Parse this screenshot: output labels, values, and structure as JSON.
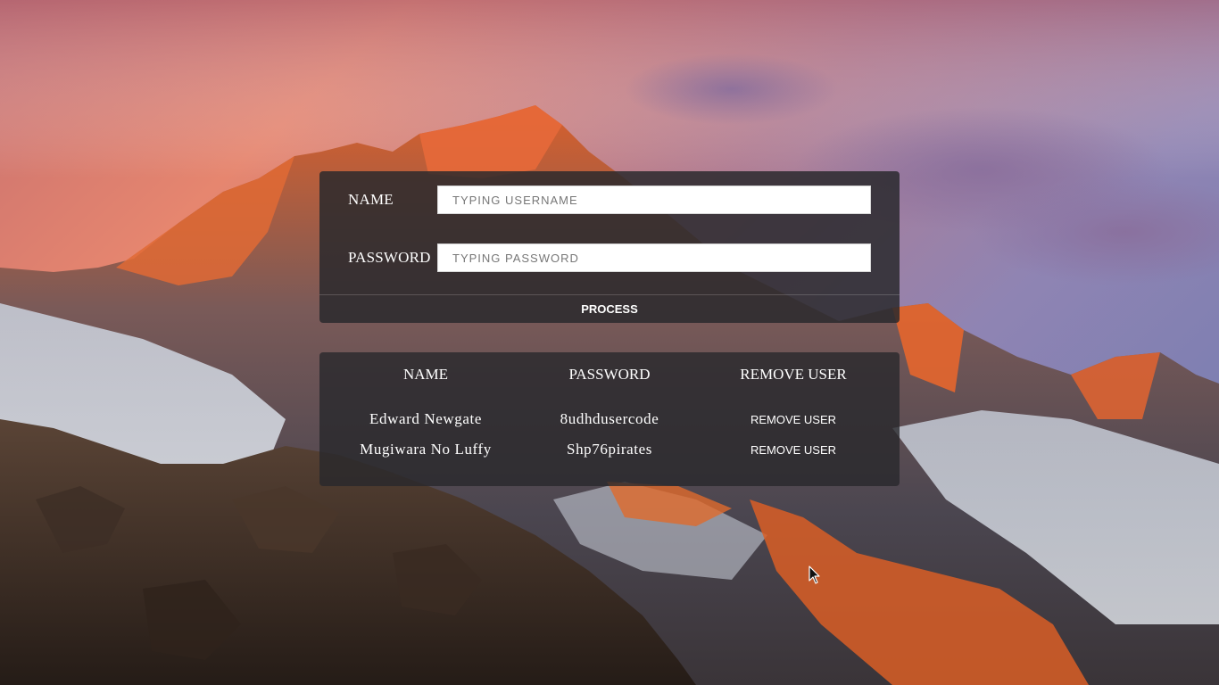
{
  "background": {
    "scene": "mountain-sunset",
    "sky_top": "#b9707a",
    "sky_glow": "#ef8d72",
    "sky_right": "#8b82b4",
    "rock_lit": "#e0622c",
    "rock_dark": "#2e241f",
    "snow": "#d6dde6"
  },
  "form": {
    "name_label": "NAME",
    "name_placeholder": "TYPING USERNAME",
    "name_value": "",
    "password_label": "PASSWORD",
    "password_placeholder": "TYPING PASSWORD",
    "password_value": "",
    "process_label": "PROCESS"
  },
  "table": {
    "headers": [
      "NAME",
      "PASSWORD",
      "REMOVE USER"
    ],
    "rows": [
      {
        "name": "Edward Newgate",
        "password": "8udhdusercode",
        "action": "REMOVE USER"
      },
      {
        "name": "Mugiwara No Luffy",
        "password": "Shp76pirates",
        "action": "REMOVE USER"
      }
    ]
  },
  "colors": {
    "panel_bg": "#28282c",
    "text": "#ffffff",
    "input_bg": "#ffffff",
    "placeholder": "#777777"
  },
  "icons": {
    "cursor": "mouse-pointer-icon"
  }
}
